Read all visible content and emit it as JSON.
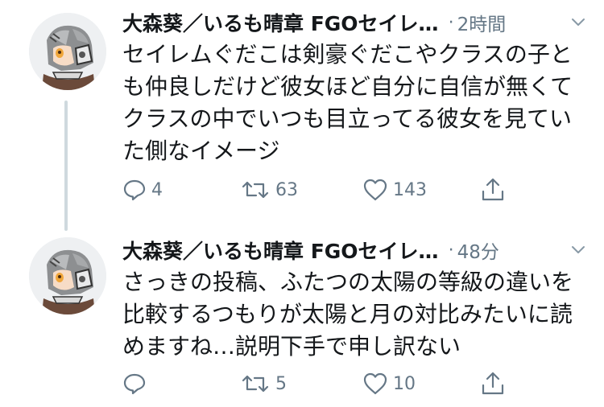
{
  "tweets": [
    {
      "author": "大森葵／いるも晴章 FGOセイレ…",
      "separator": "·",
      "time": "2時間",
      "lines": [
        "セイレムぐだこは剣豪ぐだこやクラスの子と",
        "も仲良しだけど彼女ほど自分に自信が無くて",
        "クラスの中でいつも目立ってる彼女を見てい",
        "た側なイメージ"
      ],
      "replies": "4",
      "retweets": "63",
      "likes": "143"
    },
    {
      "author": "大森葵／いるも晴章 FGOセイレ…",
      "separator": "·",
      "time": "48分",
      "lines": [
        "さっきの投稿、ふたつの太陽の等級の違いを",
        "比較するつもりが太陽と月の対比みたいに読",
        "めますね…説明下手で申し訳ない"
      ],
      "replies": "",
      "retweets": "5",
      "likes": "10"
    }
  ],
  "colors": {
    "text": "#14171a",
    "muted": "#657786",
    "thread_line": "#cfd9de"
  },
  "icons": [
    "reply-icon",
    "retweet-icon",
    "like-icon",
    "share-icon",
    "chevron-down-icon"
  ]
}
